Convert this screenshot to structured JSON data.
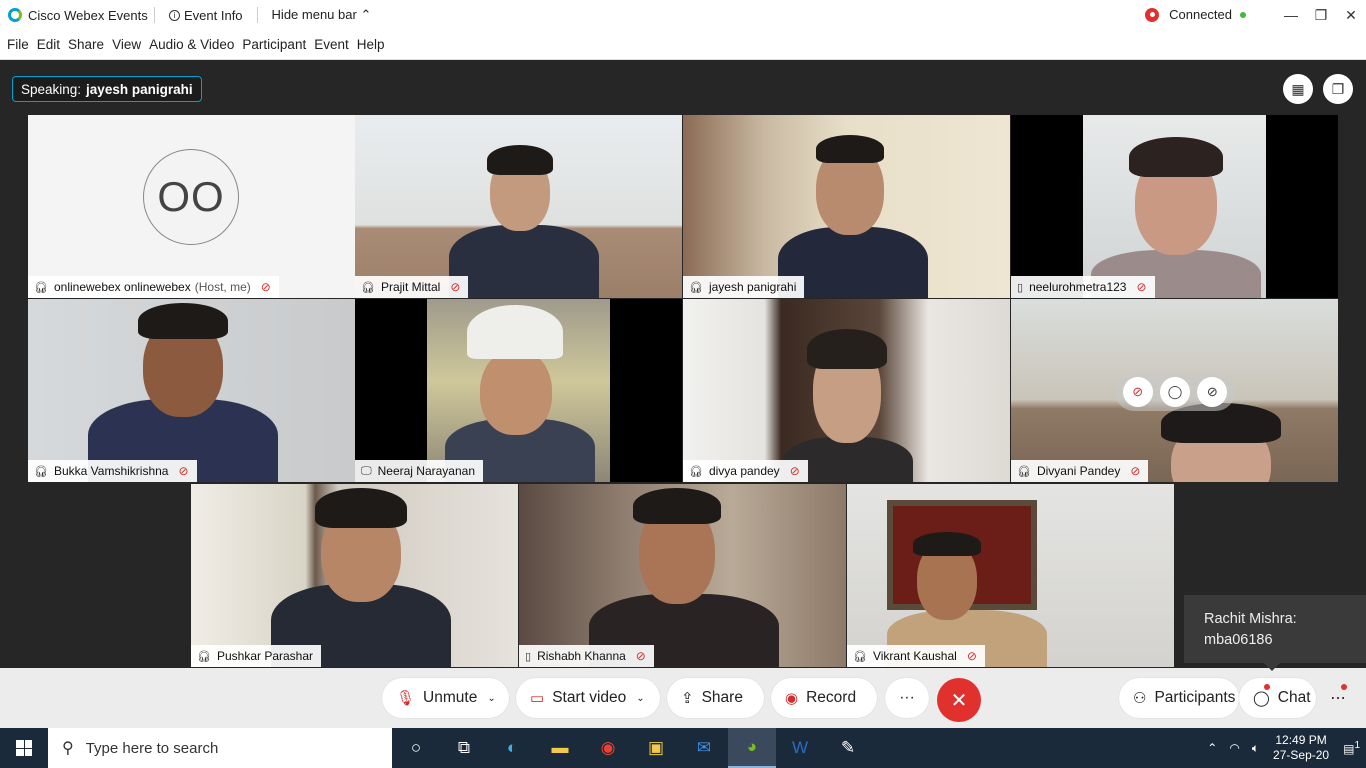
{
  "window": {
    "app_title": "Cisco Webex Events",
    "event_info": "Event Info",
    "hide_menu": "Hide menu bar",
    "status": "Connected"
  },
  "menu": [
    "File",
    "Edit",
    "Share",
    "View",
    "Audio & Video",
    "Participant",
    "Event",
    "Help"
  ],
  "speaking": {
    "label": "Speaking:",
    "name": "jayesh panigrahi"
  },
  "tiles": [
    {
      "name": "onlinewebex onlinewebex",
      "host": "(Host, me)",
      "initials": "OO"
    },
    {
      "name": "Prajit Mittal"
    },
    {
      "name": "jayesh panigrahi"
    },
    {
      "name": "neelurohmetra123"
    },
    {
      "name": "Bukka Vamshikrishna"
    },
    {
      "name": "Neeraj Narayanan"
    },
    {
      "name": "divya pandey"
    },
    {
      "name": "Divyani Pandey"
    },
    {
      "name": "Pushkar Parashar"
    },
    {
      "name": "Rishabh Khanna"
    },
    {
      "name": "Vikrant Kaushal"
    }
  ],
  "chat_popup": {
    "line1": "Rachit Mishra:",
    "line2": "mba06186"
  },
  "controls": {
    "unmute": "Unmute",
    "start_video": "Start video",
    "share": "Share",
    "record": "Record",
    "more": "···",
    "participants": "Participants",
    "chat": "Chat",
    "overflow": "⋯"
  },
  "taskbar": {
    "search_placeholder": "Type here to search",
    "time": "12:49 PM",
    "date": "27-Sep-20",
    "notifications": "1"
  },
  "colors": {
    "accent": "#07a3d6",
    "danger": "#e0312e",
    "connected": "#3dbb3d"
  }
}
